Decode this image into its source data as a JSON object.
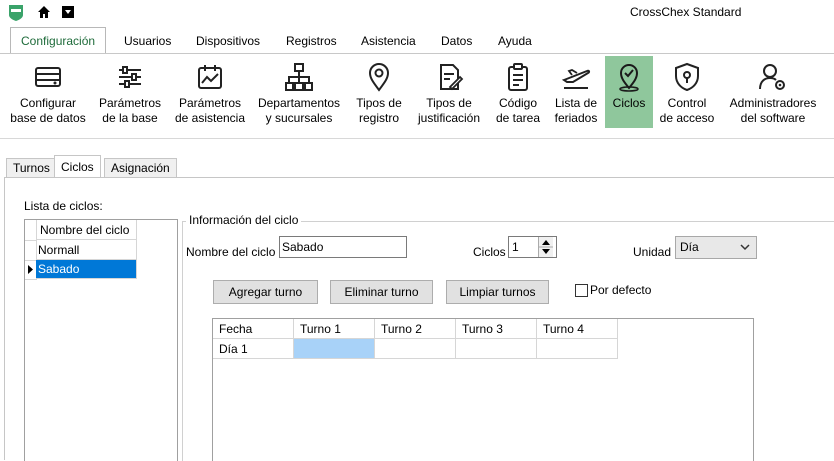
{
  "window": {
    "title": "CrossChex Standard"
  },
  "menu_tabs": [
    "Configuración",
    "Usuarios",
    "Dispositivos",
    "Registros",
    "Asistencia",
    "Datos",
    "Ayuda"
  ],
  "ribbon": [
    {
      "l1": "Configurar",
      "l2": "base de datos",
      "icon": "database-icon"
    },
    {
      "l1": "Parámetros",
      "l2": "de la base",
      "icon": "sliders-icon"
    },
    {
      "l1": "Parámetros",
      "l2": "de asistencia",
      "icon": "calendar-chart-icon"
    },
    {
      "l1": "Departamentos",
      "l2": "y sucursales",
      "icon": "org-chart-icon"
    },
    {
      "l1": "Tipos de",
      "l2": "registro",
      "icon": "location-pin-icon"
    },
    {
      "l1": "Tipos de",
      "l2": "justificación",
      "icon": "document-edit-icon"
    },
    {
      "l1": "Código",
      "l2": "de tarea",
      "icon": "clipboard-icon"
    },
    {
      "l1": "Lista de",
      "l2": "feriados",
      "icon": "plane-icon"
    },
    {
      "l1": "Ciclos",
      "l2": "",
      "icon": "cycle-pin-icon"
    },
    {
      "l1": "Control",
      "l2": "de acceso",
      "icon": "shield-lock-icon"
    },
    {
      "l1": "Administradores",
      "l2": "del software",
      "icon": "user-gear-icon"
    }
  ],
  "subtabs": [
    "Turnos",
    "Ciclos",
    "Asignación"
  ],
  "cycles_list": {
    "label": "Lista de ciclos:",
    "header": "Nombre del ciclo",
    "rows": [
      "Normall",
      "Sabado"
    ]
  },
  "cycle_info": {
    "group_title": "Información del ciclo",
    "name_label": "Nombre del ciclo",
    "name_value": "Sabado",
    "cycles_label": "Ciclos",
    "cycles_value": "1",
    "unit_label": "Unidad",
    "unit_value": "Día",
    "add_btn": "Agregar turno",
    "delete_btn": "Eliminar turno",
    "clear_btn": "Limpiar turnos",
    "default_label": "Por defecto"
  },
  "shift_grid": {
    "headers": [
      "Fecha",
      "Turno 1",
      "Turno 2",
      "Turno 3",
      "Turno 4"
    ],
    "rows": [
      [
        "Día 1",
        "",
        "",
        "",
        ""
      ]
    ]
  },
  "colors": {
    "accent": "#1e6b3a",
    "active_ribbon": "#8fc79c",
    "selected_row": "#0078d7",
    "selected_cell": "#a8d2f8"
  }
}
